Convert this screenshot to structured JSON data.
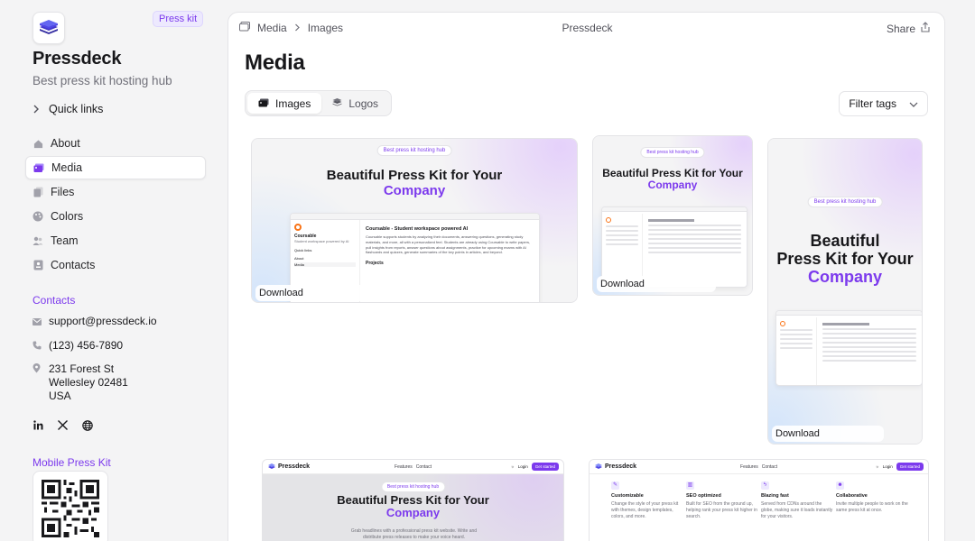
{
  "sidebar": {
    "badge": "Press kit",
    "brand": "Pressdeck",
    "tagline": "Best press kit hosting hub",
    "quick_links": "Quick links",
    "nav": [
      {
        "label": "About",
        "icon": "home-icon"
      },
      {
        "label": "Media",
        "icon": "images-icon",
        "active": true
      },
      {
        "label": "Files",
        "icon": "files-icon"
      },
      {
        "label": "Colors",
        "icon": "palette-icon"
      },
      {
        "label": "Team",
        "icon": "users-icon"
      },
      {
        "label": "Contacts",
        "icon": "contact-card-icon"
      }
    ],
    "contacts_title": "Contacts",
    "email": "support@pressdeck.io",
    "phone": "(123) 456-7890",
    "address": [
      "231 Forest St",
      "Wellesley 02481",
      "USA"
    ],
    "socials": [
      "linkedin-icon",
      "x-icon",
      "globe-icon"
    ],
    "mobile_title": "Mobile Press Kit"
  },
  "topbar": {
    "crumbs": [
      "Media",
      "Images"
    ],
    "center_title": "Pressdeck",
    "share": "Share"
  },
  "main": {
    "title": "Media",
    "tabs": [
      {
        "label": "Images",
        "active": true
      },
      {
        "label": "Logos",
        "active": false
      }
    ],
    "filter": "Filter tags",
    "download_label": "Download",
    "mock": {
      "pill": "Best press kit hosting hub",
      "headline_1": "Beautiful Press Kit for Your",
      "headline_accent": "Company",
      "headline_tall_1": "Beautiful",
      "headline_tall_2": "Press Kit for Your",
      "mini_brand": "Coursable",
      "mini_sub": "Student workspace powered by AI",
      "mini_title": "Coursable - Student workspace powered AI",
      "mini_nav_about": "About",
      "mini_center": "Coursable",
      "mini_share": "Share",
      "mini_quick": "Quick links",
      "mini_media": "Media",
      "mini_projects": "Projects",
      "mini_body": "Coursable supports students by analyzing their documents, answering questions, generating study materials, and more, all with a personalized feel. Students are already using Coursable to write papers, pull insights from reports, answer questions about assignments, practice for upcoming exams with AI flashcards and quizzes, generate summaries of the key points in articles, and beyond.",
      "site_brand": "Pressdeck",
      "site_links": [
        "Features",
        "Contact"
      ],
      "site_login": "Login",
      "site_cta": "Get started",
      "site_desc": "Grab headlines with a professional press kit website. Write and distribute press releases to make your voice heard.",
      "features": [
        {
          "title": "Customizable",
          "desc": "Change the style of your press kit with themes, design templates, colors, and more."
        },
        {
          "title": "SEO optimized",
          "desc": "Built for SEO from the ground up, helping rank your press kit higher in search."
        },
        {
          "title": "Blazing fast",
          "desc": "Served from CDNs around the globe, making sure it loads instantly for your visitors."
        },
        {
          "title": "Collaborative",
          "desc": "Invite multiple people to work on the same press kit at once."
        }
      ]
    }
  },
  "colors": {
    "accent": "#7c3aed",
    "accent_soft": "#ede9fe"
  }
}
